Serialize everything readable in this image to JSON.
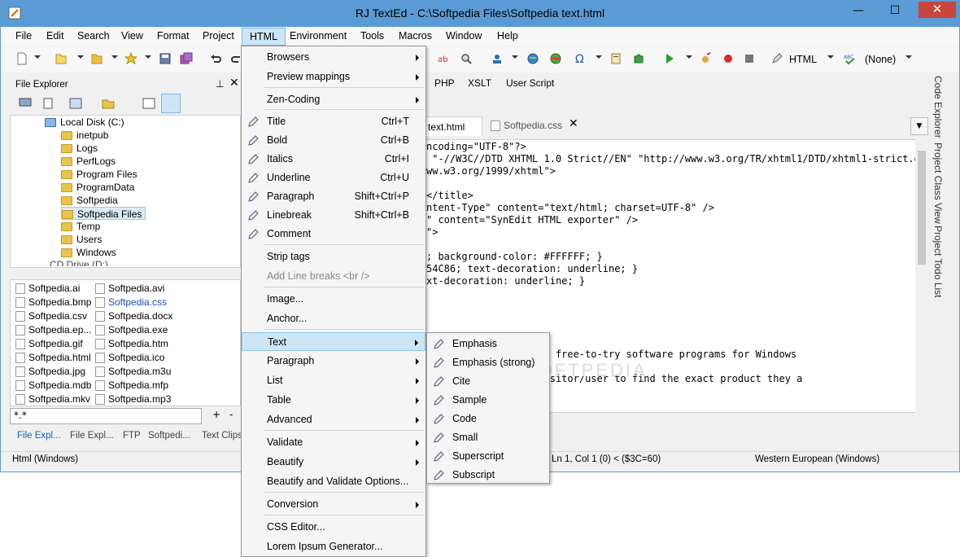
{
  "window": {
    "title": "RJ TextEd - C:\\Softpedia Files\\Softpedia text.html",
    "minimize": "—",
    "maximize": "☐",
    "close": "✕"
  },
  "menubar": [
    "File",
    "Edit",
    "Search",
    "View",
    "Format",
    "Project",
    "HTML",
    "Environment",
    "Tools",
    "Macros",
    "Window",
    "Help"
  ],
  "toolbar": {
    "syntax_mode": "HTML",
    "spell_mode": "(None)"
  },
  "left_panel": {
    "title": "File Explorer",
    "tree": [
      "Local Disk (C:)",
      "inetpub",
      "Logs",
      "PerfLogs",
      "Program Files",
      "ProgramData",
      "Softpedia",
      "Softpedia Files",
      "Temp",
      "Users",
      "Windows",
      "CD Drive (D:)"
    ],
    "files_col1": [
      "Softpedia.ai",
      "Softpedia.bmp",
      "Softpedia.csv",
      "Softpedia.ep...",
      "Softpedia.gif",
      "Softpedia.html",
      "Softpedia.jpg",
      "Softpedia.mdb",
      "Softpedia.mkv"
    ],
    "files_col2": [
      "Softpedia.avi",
      "Softpedia.css",
      "Softpedia.docx",
      "Softpedia.exe",
      "Softpedia.htm",
      "Softpedia.ico",
      "Softpedia.m3u",
      "Softpedia.mfp",
      "Softpedia.mp3"
    ],
    "filter": "*.*",
    "filter_add": "+",
    "filter_remove": "-",
    "tabs": [
      "File Expl...",
      "File Expl...",
      "FTP",
      "Softpedi...",
      "Text Clips"
    ]
  },
  "snippet_tabs": [
    "PHP",
    "XSLT",
    "User Script"
  ],
  "doc_tabs": [
    "text.html",
    "Softpedia.css"
  ],
  "code_lines": [
    {
      "t": "ncoding=\"UTF-8\"?>"
    },
    {
      "t": " \"-//W3C//DTD XHTML 1.0 Strict//EN\" \"http://www.w3.org/TR/xhtml1/DTD/xhtml1-strict.dtd"
    },
    {
      "t": "ww.w3.org/1999/xhtml\">"
    },
    {
      "t": ""
    },
    {
      "t": "</title>"
    },
    {
      "t": "ntent-Type\" content=\"text/html; charset=UTF-8\" />"
    },
    {
      "t": "\" content=\"SynEdit HTML exporter\" />"
    },
    {
      "t": "\">"
    },
    {
      "t": ""
    },
    {
      "t": "; background-color: #FFFFFF; }"
    },
    {
      "t": "54C86; text-decoration: underline; }"
    },
    {
      "t": "xt-decoration: underline; }"
    },
    {
      "t": ""
    },
    {
      "t": ""
    },
    {
      "t": ""
    },
    {
      "t": ""
    },
    {
      "t": ""
    },
    {
      "t": "er 1,300,000 free and free-to-try software programs for Windows"
    },
    {
      "t": ""
    },
    {
      "t": "order to allow the visitor/user to find the exact product they a"
    }
  ],
  "status": {
    "mode": "Html (Windows)",
    "position": "Ln 1, Col 1 (0) < ($3C=60)",
    "encoding": "Western European (Windows)"
  },
  "right_side_tabs": [
    "Code Explorer",
    "Project Class View",
    "Project Todo List"
  ],
  "html_menu": {
    "items": [
      {
        "label": "Browsers",
        "sub": true
      },
      {
        "label": "Preview mappings",
        "sub": true
      },
      {
        "label": "Zen-Coding",
        "sub": true
      },
      {
        "label": "Title",
        "shortcut": "Ctrl+T"
      },
      {
        "label": "Bold",
        "shortcut": "Ctrl+B"
      },
      {
        "label": "Italics",
        "shortcut": "Ctrl+I"
      },
      {
        "label": "Underline",
        "shortcut": "Ctrl+U"
      },
      {
        "label": "Paragraph",
        "shortcut": "Shift+Ctrl+P"
      },
      {
        "label": "Linebreak",
        "shortcut": "Shift+Ctrl+B"
      },
      {
        "label": "Comment"
      },
      {
        "label": "Strip tags"
      },
      {
        "label": "Add Line breaks <br />",
        "disabled": true
      },
      {
        "label": "Image..."
      },
      {
        "label": "Anchor..."
      },
      {
        "label": "Text",
        "sub": true
      },
      {
        "label": "Paragraph",
        "sub": true
      },
      {
        "label": "List",
        "sub": true
      },
      {
        "label": "Table",
        "sub": true
      },
      {
        "label": "Advanced",
        "sub": true
      },
      {
        "label": "Validate",
        "sub": true
      },
      {
        "label": "Beautify",
        "sub": true
      },
      {
        "label": "Beautify and Validate Options..."
      },
      {
        "label": "Conversion",
        "sub": true
      },
      {
        "label": "CSS Editor..."
      },
      {
        "label": "Lorem Ipsum Generator..."
      }
    ]
  },
  "text_submenu": [
    "Emphasis",
    "Emphasis (strong)",
    "Cite",
    "Sample",
    "Code",
    "Small",
    "Superscript",
    "Subscript"
  ],
  "watermark": "SOFTPEDIA"
}
